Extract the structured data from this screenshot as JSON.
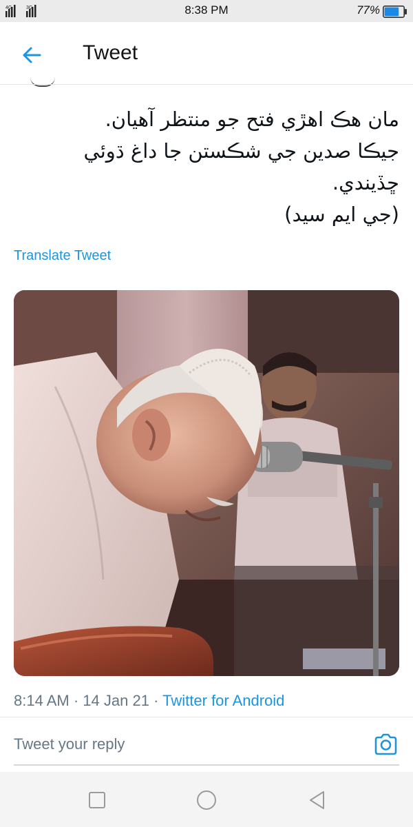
{
  "status_bar": {
    "network_top": "4G",
    "network_second": "3G",
    "time": "8:38 PM",
    "battery_percent": "77%",
    "battery_level": 0.77
  },
  "header": {
    "title": "Tweet",
    "back_icon": "arrow-left-icon"
  },
  "tweet": {
    "text_lines": [
      "مان هڪ اهڙي فتح جو منتظر آهيان.",
      "جيڪا صدين جي شڪستن جا داغ ڌوئي",
      "ڇڏيندي.",
      "(جي ايم سيد)"
    ],
    "translate_label": "Translate Tweet",
    "time": "8:14 AM",
    "separator": "·",
    "date": "14 Jan 21",
    "source": "Twitter for Android"
  },
  "reply": {
    "placeholder": "Tweet your reply",
    "value": "",
    "camera_icon": "camera-icon"
  },
  "nav": {
    "recents_icon": "square-icon",
    "home_icon": "circle-icon",
    "back_icon": "triangle-back-icon"
  },
  "colors": {
    "accent": "#1b95e0",
    "meta_gray": "#657786",
    "status_bar_bg": "#ebebeb",
    "battery_fill": "#1e88e5"
  }
}
